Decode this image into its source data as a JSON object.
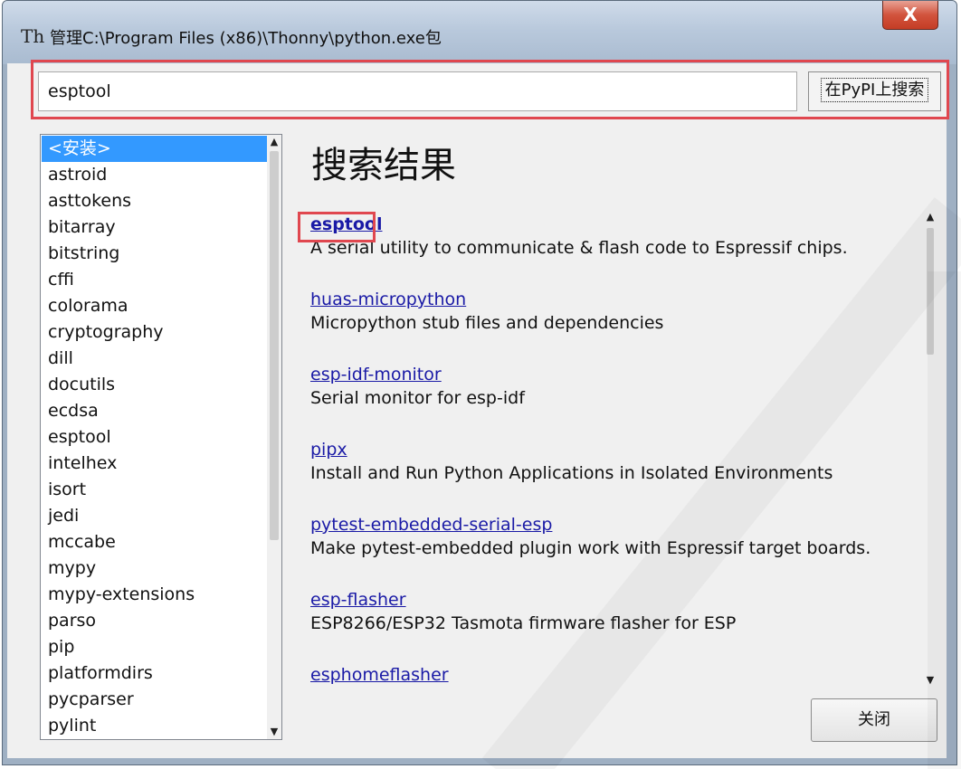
{
  "window": {
    "title": "管理C:\\Program Files (x86)\\Thonny\\python.exe包",
    "app_icon": "thonny-icon",
    "close_glyph": "X"
  },
  "search": {
    "value": "esptool",
    "button_label": "在PyPI上搜索"
  },
  "package_list": {
    "items": [
      "<安装>",
      "astroid",
      "asttokens",
      "bitarray",
      "bitstring",
      "cffi",
      "colorama",
      "cryptography",
      "dill",
      "docutils",
      "ecdsa",
      "esptool",
      "intelhex",
      "isort",
      "jedi",
      "mccabe",
      "mypy",
      "mypy-extensions",
      "parso",
      "pip",
      "platformdirs",
      "pycparser",
      "pylint"
    ],
    "selected_index": 0
  },
  "results": {
    "title": "搜索结果",
    "items": [
      {
        "name": "esptool",
        "description": "A serial utility to communicate & flash code to Espressif chips."
      },
      {
        "name": "huas-micropython",
        "description": "Micropython stub files and dependencies"
      },
      {
        "name": "esp-idf-monitor",
        "description": "Serial monitor for esp-idf"
      },
      {
        "name": "pipx",
        "description": "Install and Run Python Applications in Isolated Environments"
      },
      {
        "name": "pytest-embedded-serial-esp",
        "description": "Make pytest-embedded plugin work with Espressif target boards."
      },
      {
        "name": "esp-flasher",
        "description": "ESP8266/ESP32 Tasmota firmware flasher for ESP"
      },
      {
        "name": "esphomeflasher",
        "description": ""
      }
    ]
  },
  "footer": {
    "close_label": "关闭"
  },
  "colors": {
    "highlight_border": "#e0474f",
    "selection": "#3399ff",
    "link": "#1a1aa6"
  }
}
